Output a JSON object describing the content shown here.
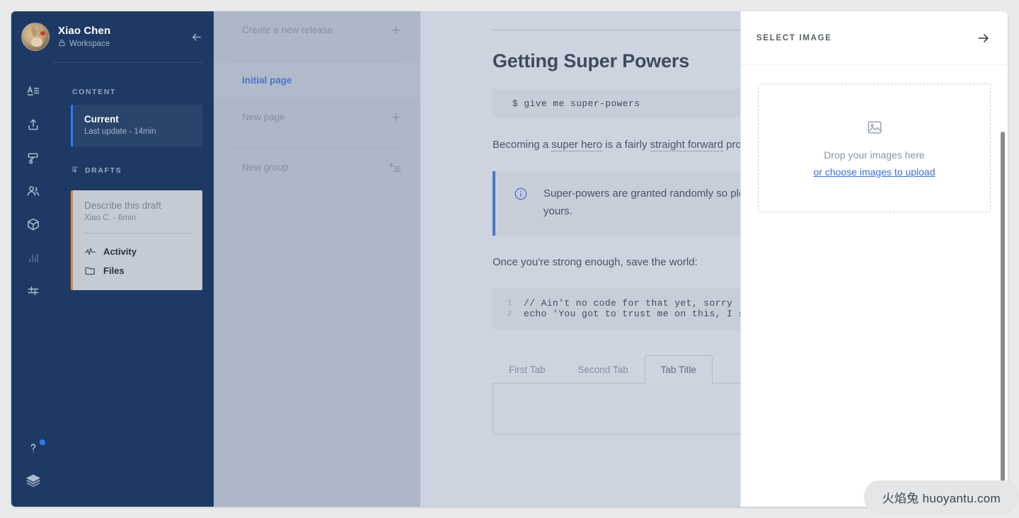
{
  "sidebar": {
    "user_name": "Xiao Chen",
    "workspace_label": "Workspace",
    "lock_icon": "lock-icon",
    "collapse_icon": "arrow-left-icon",
    "rail_icons": [
      "text-format-icon",
      "upload-icon",
      "paint-roller-icon",
      "people-icon",
      "box-icon",
      "bar-chart-icon",
      "sliders-icon"
    ],
    "rail_bottom_icons": [
      "help-question-icon",
      "layers-stack-icon"
    ],
    "content_label": "CONTENT",
    "current": {
      "title": "Current",
      "subtitle": "Last update - 14min"
    },
    "drafts_label": "DRAFTS",
    "drafts_icon": "branch-icon",
    "draft": {
      "title": "Describe this draft",
      "subtitle": "Xiao C. - 6min",
      "links": [
        {
          "label": "Activity",
          "icon": "activity-pulse-icon"
        },
        {
          "label": "Files",
          "icon": "folder-icon"
        }
      ]
    }
  },
  "navpanel": {
    "create_release": "Create a new release",
    "create_release_icon": "plus-icon",
    "items": [
      {
        "label": "Initial page",
        "icon": "",
        "active": true
      },
      {
        "label": "New page",
        "icon": "plus-icon",
        "active": false
      },
      {
        "label": "New group",
        "icon": "add-list-icon",
        "active": false
      }
    ]
  },
  "document": {
    "title": "Getting Super Powers",
    "command_block": "$ give me super-powers",
    "paragraph_prefix": "Becoming a ",
    "paragraph_link1": "super hero",
    "paragraph_mid": " is a fairly ",
    "paragraph_link2": "straight forward",
    "paragraph_suffix": " process:",
    "callout_icon": "info-circle-icon",
    "callout_text": "Super-powers are granted randomly so please submit an issue if you're not happy with yours.",
    "paragraph2": "Once you're strong enough, save the world:",
    "code_lines": [
      {
        "num": "1",
        "text": "// Ain't no code for that yet, sorry"
      },
      {
        "num": "2",
        "text": "echo 'You got to trust me on this, I saved the world'"
      }
    ],
    "tabs": [
      {
        "label": "First Tab",
        "active": false
      },
      {
        "label": "Second Tab",
        "active": false
      },
      {
        "label": "Tab Title",
        "active": true
      }
    ]
  },
  "right_panel": {
    "title": "SELECT IMAGE",
    "close_icon": "arrow-right-icon",
    "dropzone": {
      "icon": "image-placeholder-icon",
      "text": "Drop your images here",
      "link": "or choose images to upload"
    }
  },
  "watermark": {
    "text": "火焰兔 huoyantu.com"
  },
  "colors": {
    "sidebar_bg": "#1e3a64",
    "accent_blue": "#3b6fd4",
    "draft_orange": "#d98a3c",
    "main_bg": "#eff1f4",
    "panel_bg": "#ffffff"
  }
}
